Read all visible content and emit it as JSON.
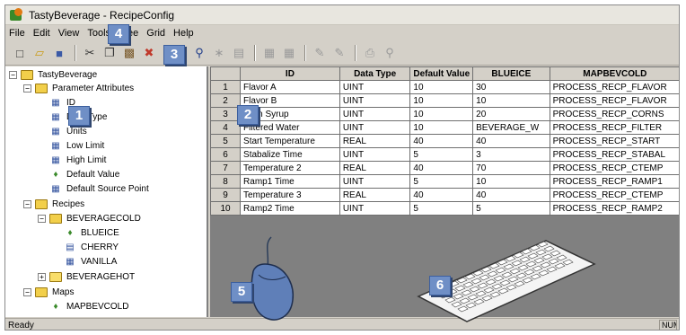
{
  "window": {
    "title": "TastyBeverage - RecipeConfig"
  },
  "menu": [
    "File",
    "Edit",
    "View",
    "Tools",
    "Tree",
    "Grid",
    "Help"
  ],
  "toolbar": {
    "buttons": [
      "new-icon",
      "open-icon",
      "save-icon",
      "cut-icon",
      "copy-icon",
      "paste-icon",
      "delete-icon",
      "help-icon",
      "find-icon",
      "wand-icon",
      "clipboard-icon",
      "insert-row-icon",
      "insert-col-icon",
      "add-node-icon",
      "edit-node-icon",
      "print-icon",
      "preview-icon"
    ]
  },
  "tree": {
    "root": "TastyBeverage",
    "parameter_attributes": "Parameter Attributes",
    "attr_items": [
      "ID",
      "Data Type",
      "Units",
      "Low Limit",
      "High Limit",
      "Default Value",
      "Default Source Point"
    ],
    "recipes": "Recipes",
    "beveragecold": "BEVERAGECOLD",
    "beveragecold_items": [
      "BLUEICE",
      "CHERRY",
      "VANILLA"
    ],
    "beveragehot": "BEVERAGEHOT",
    "maps": "Maps",
    "maps_items": [
      "MAPBEVCOLD"
    ]
  },
  "grid": {
    "headers": [
      "",
      "ID",
      "Data Type",
      "Default Value",
      "BLUEICE",
      "MAPBEVCOLD"
    ],
    "rows": [
      [
        "1",
        "Flavor A",
        "UINT",
        "10",
        "30",
        "PROCESS_RECP_FLAVOR"
      ],
      [
        "2",
        "Flavor B",
        "UINT",
        "10",
        "10",
        "PROCESS_RECP_FLAVOR"
      ],
      [
        "3",
        "Corn Syrup",
        "UINT",
        "10",
        "20",
        "PROCESS_RECP_CORNS"
      ],
      [
        "4",
        "Filtered Water",
        "UINT",
        "10",
        "BEVERAGE_W",
        "PROCESS_RECP_FILTER"
      ],
      [
        "5",
        "Start Temperature",
        "REAL",
        "40",
        "40",
        "PROCESS_RECP_START"
      ],
      [
        "6",
        "Stabalize Time",
        "UINT",
        "5",
        "3",
        "PROCESS_RECP_STABAL"
      ],
      [
        "7",
        "Temperature 2",
        "REAL",
        "40",
        "70",
        "PROCESS_RECP_CTEMP"
      ],
      [
        "8",
        "Ramp1 Time",
        "UINT",
        "5",
        "10",
        "PROCESS_RECP_RAMP1"
      ],
      [
        "9",
        "Temperature 3",
        "REAL",
        "40",
        "40",
        "PROCESS_RECP_CTEMP"
      ],
      [
        "10",
        "Ramp2 Time",
        "UINT",
        "5",
        "5",
        "PROCESS_RECP_RAMP2"
      ]
    ]
  },
  "status": {
    "text": "Ready",
    "num": "NUM"
  },
  "callouts": [
    "1",
    "2",
    "3",
    "4",
    "5",
    "6"
  ],
  "colors": {
    "callout": "#6f8fc6",
    "panel": "#d4d0c8",
    "grid_bg": "#808080"
  }
}
